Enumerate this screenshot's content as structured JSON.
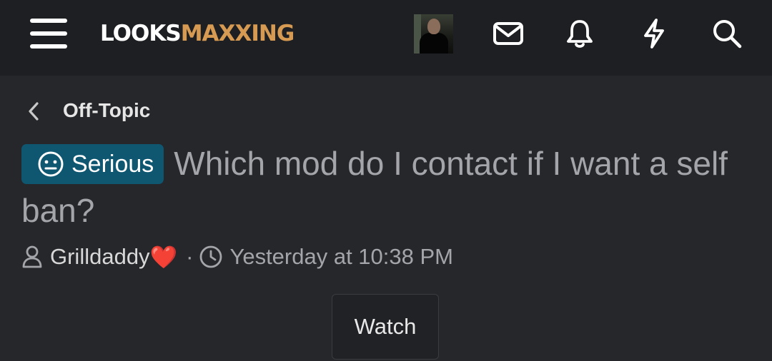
{
  "header": {
    "logo_part1": "LOOKS",
    "logo_part2": "MAXXING",
    "accent_color": "#d69a52",
    "icons": [
      "menu-icon",
      "envelope-icon",
      "bell-icon",
      "lightning-icon",
      "search-icon"
    ]
  },
  "breadcrumb": {
    "label": "Off-Topic"
  },
  "thread": {
    "prefix": "Serious",
    "prefix_color": "#0f5771",
    "title": "Which mod do I contact if I want a self ban?",
    "author": "Grilldaddy",
    "author_emoji": "❤️",
    "separator": "·",
    "timestamp": "Yesterday at 10:38 PM"
  },
  "actions": {
    "watch_label": "Watch"
  }
}
